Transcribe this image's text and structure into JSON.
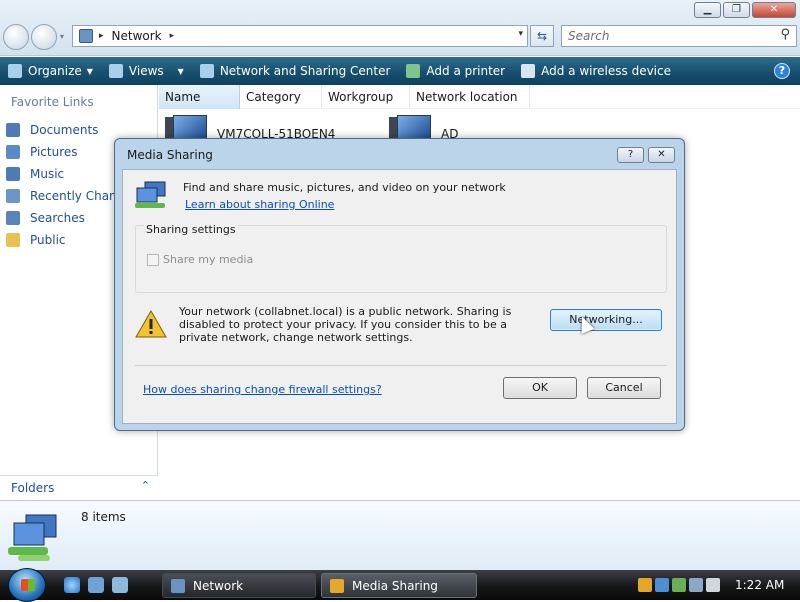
{
  "window": {
    "minimize_label": "▁",
    "maximize_label": "❐",
    "close_label": "✕"
  },
  "address_bar": {
    "path_root_sep": "▸",
    "location": "Network",
    "trail_sep": "▸",
    "dropdown": "▾",
    "refresh": "⇆"
  },
  "search": {
    "placeholder": "Search",
    "icon": "magnifier-icon"
  },
  "toolbar": {
    "organize": "Organize",
    "views": "Views",
    "network_sharing_center": "Network and Sharing Center",
    "add_printer": "Add a printer",
    "add_wireless": "Add a wireless device",
    "help": "?"
  },
  "navigation": {
    "favorite_links_title": "Favorite Links",
    "items": [
      {
        "label": "Documents",
        "icon": "documents-icon",
        "color": "#4f79b7"
      },
      {
        "label": "Pictures",
        "icon": "pictures-icon",
        "color": "#5a8bc6"
      },
      {
        "label": "Music",
        "icon": "music-icon",
        "color": "#4c7bb8"
      },
      {
        "label": "Recently Changed",
        "icon": "recent-icon",
        "color": "#6a96c8"
      },
      {
        "label": "Searches",
        "icon": "searches-icon",
        "color": "#5a84b8"
      },
      {
        "label": "Public",
        "icon": "folder-icon",
        "color": "#e8c14f"
      }
    ],
    "folders_label": "Folders",
    "folders_chevron": "⌃"
  },
  "content": {
    "columns": [
      "Name",
      "Category",
      "Workgroup",
      "Network location"
    ],
    "computers": [
      "VM7COLL-51BOEN4",
      "AD"
    ]
  },
  "details": {
    "item_count": "8 items"
  },
  "dialog": {
    "title": "Media Sharing",
    "help_btn": "?",
    "close_btn": "✕",
    "intro": "Find and share music, pictures, and video on your network",
    "learn_link": "Learn about sharing Online",
    "group_title": "Sharing settings",
    "share_media": "Share my media",
    "warning": "Your network (collabnet.local) is a public network. Sharing is disabled to protect your privacy. If you consider this to be a private network, change network settings.",
    "networking_btn": "Networking...",
    "firewall_link": "How does sharing change firewall settings?",
    "ok": "OK",
    "cancel": "Cancel"
  },
  "taskbar": {
    "tasks": [
      {
        "label": "Network",
        "icon": "network-icon"
      },
      {
        "label": "Media Sharing",
        "icon": "media-icon"
      }
    ],
    "clock": "1:22 AM"
  },
  "colors": {
    "toolbar": "#184f6e",
    "link": "#0a4fb8",
    "dialog_frame": "#bcd4ea"
  }
}
